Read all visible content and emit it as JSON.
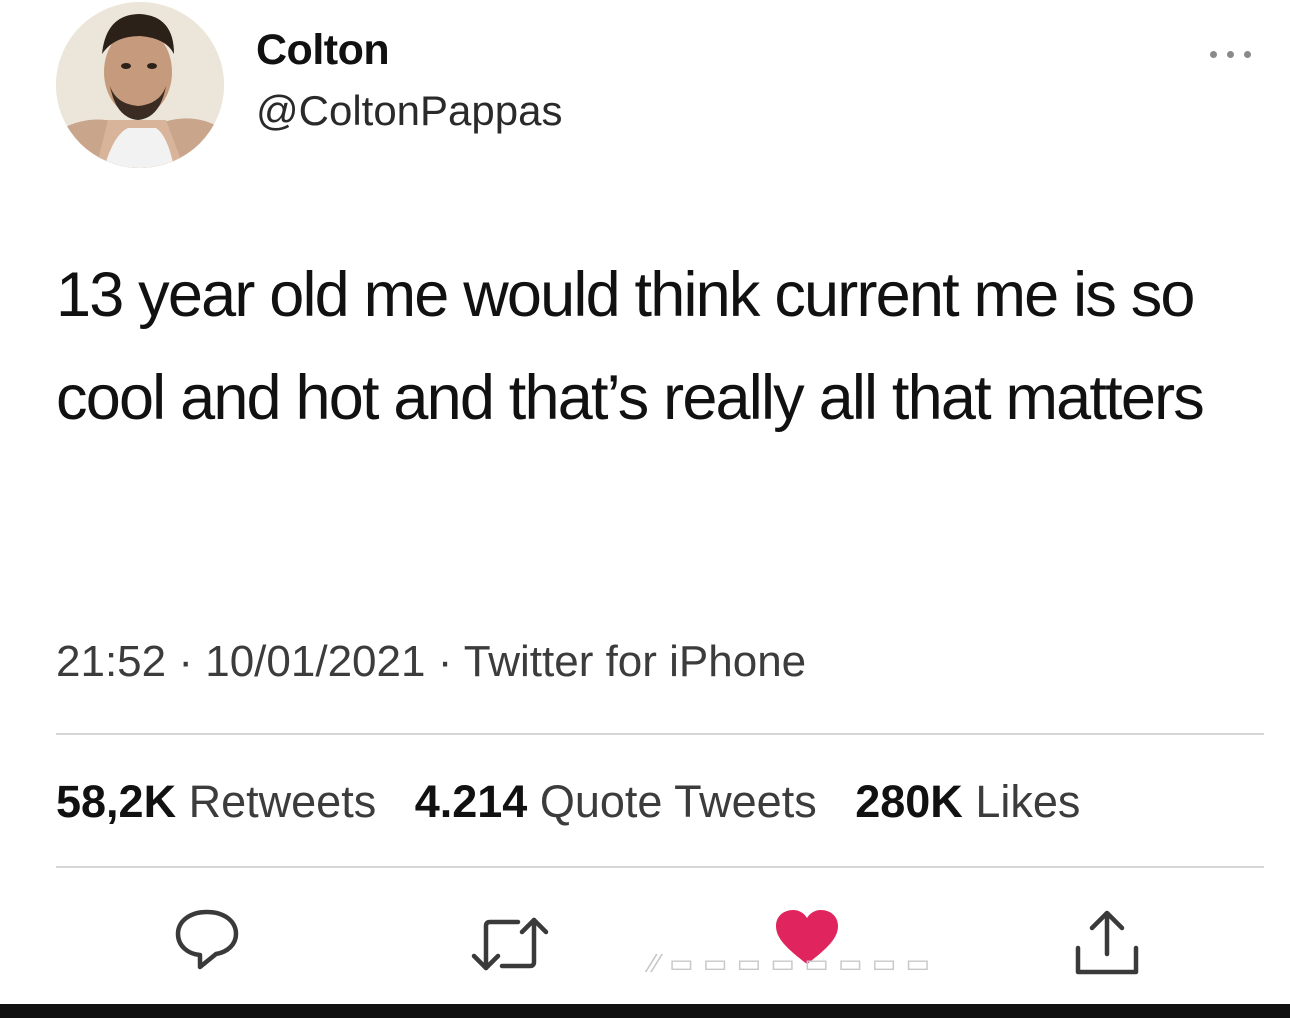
{
  "author": {
    "display_name": "Colton",
    "handle": "@ColtonPappas",
    "avatar_icon": "profile-photo"
  },
  "tweet": {
    "text": "13 year old me would think current me is so cool and hot and that’s really all that matters",
    "time": "21:52",
    "date": "10/01/2021",
    "separator": "·",
    "source": "Twitter for iPhone"
  },
  "stats": {
    "retweets_count": "58,2K",
    "retweets_label": "Retweets",
    "quotes_count": "4.214",
    "quotes_label": "Quote Tweets",
    "likes_count": "280K",
    "likes_label": "Likes"
  },
  "actions": {
    "reply_icon": "reply-icon",
    "retweet_icon": "retweet-icon",
    "like_icon": "heart-icon",
    "share_icon": "share-icon",
    "like_color": "#e0245e",
    "icon_color": "#3a3a3a"
  }
}
